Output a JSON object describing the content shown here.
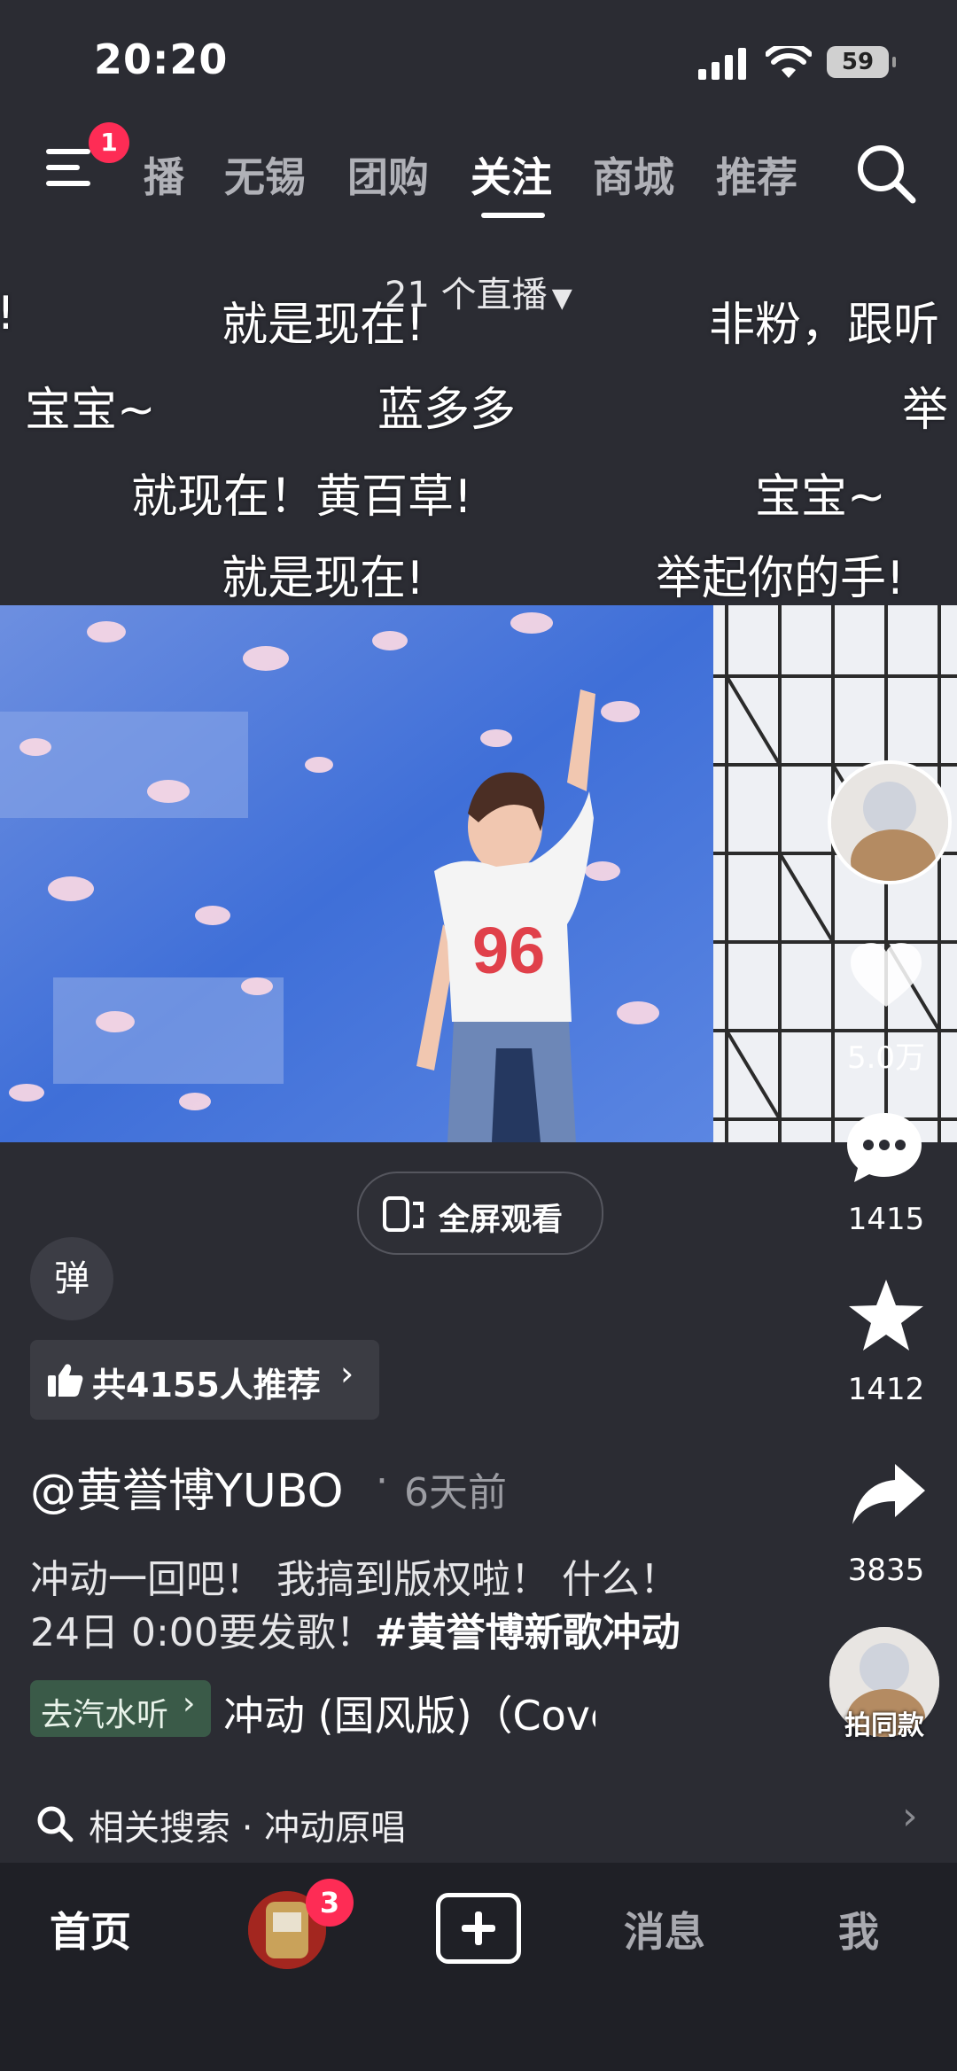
{
  "status_bar": {
    "time": "20:20",
    "battery": "59"
  },
  "top_nav": {
    "menu_badge": "1",
    "tabs": [
      {
        "label": "播"
      },
      {
        "label": "无锡"
      },
      {
        "label": "团购"
      },
      {
        "label": "关注"
      },
      {
        "label": "商城"
      },
      {
        "label": "推荐"
      }
    ]
  },
  "live": {
    "count_label": "21 个直播"
  },
  "danmaku": [
    "!",
    "就是现在!",
    "非粉，跟听",
    "宝宝~",
    "蓝多多",
    "举",
    "就现在！黄百草!",
    "宝宝~",
    "就是现在!",
    "举起你的手!"
  ],
  "video": {
    "shirt_number": "96"
  },
  "sidebar": {
    "likes": "5.0万",
    "comments": "1415",
    "favorites": "1412",
    "shares": "3835",
    "same_style_label": "拍同款"
  },
  "player": {
    "fullscreen_label": "全屏观看",
    "danmu_label": "弹"
  },
  "post": {
    "recommend_label": "共4155人推荐",
    "author": "@黄誉博YUBO",
    "separator": "·",
    "time_ago": "6天前",
    "desc_line1": "冲动一回吧！ 我搞到版权啦！ 什么！",
    "desc_line2_prefix": "24日 0:00要发歌！",
    "hashtag": "#黄誉博新歌冲动",
    "music_tag": "去汽水听",
    "song": "冲动 (国风版)（Cover"
  },
  "related_search": {
    "label": "相关搜索 · 冲动原唱"
  },
  "bottom_nav": {
    "home": "首页",
    "friends_badge": "3",
    "messages": "消息",
    "me": "我"
  },
  "colors": {
    "accent": "#fe2c55",
    "background": "#2b2c33",
    "nav_bg": "#1f2026"
  }
}
